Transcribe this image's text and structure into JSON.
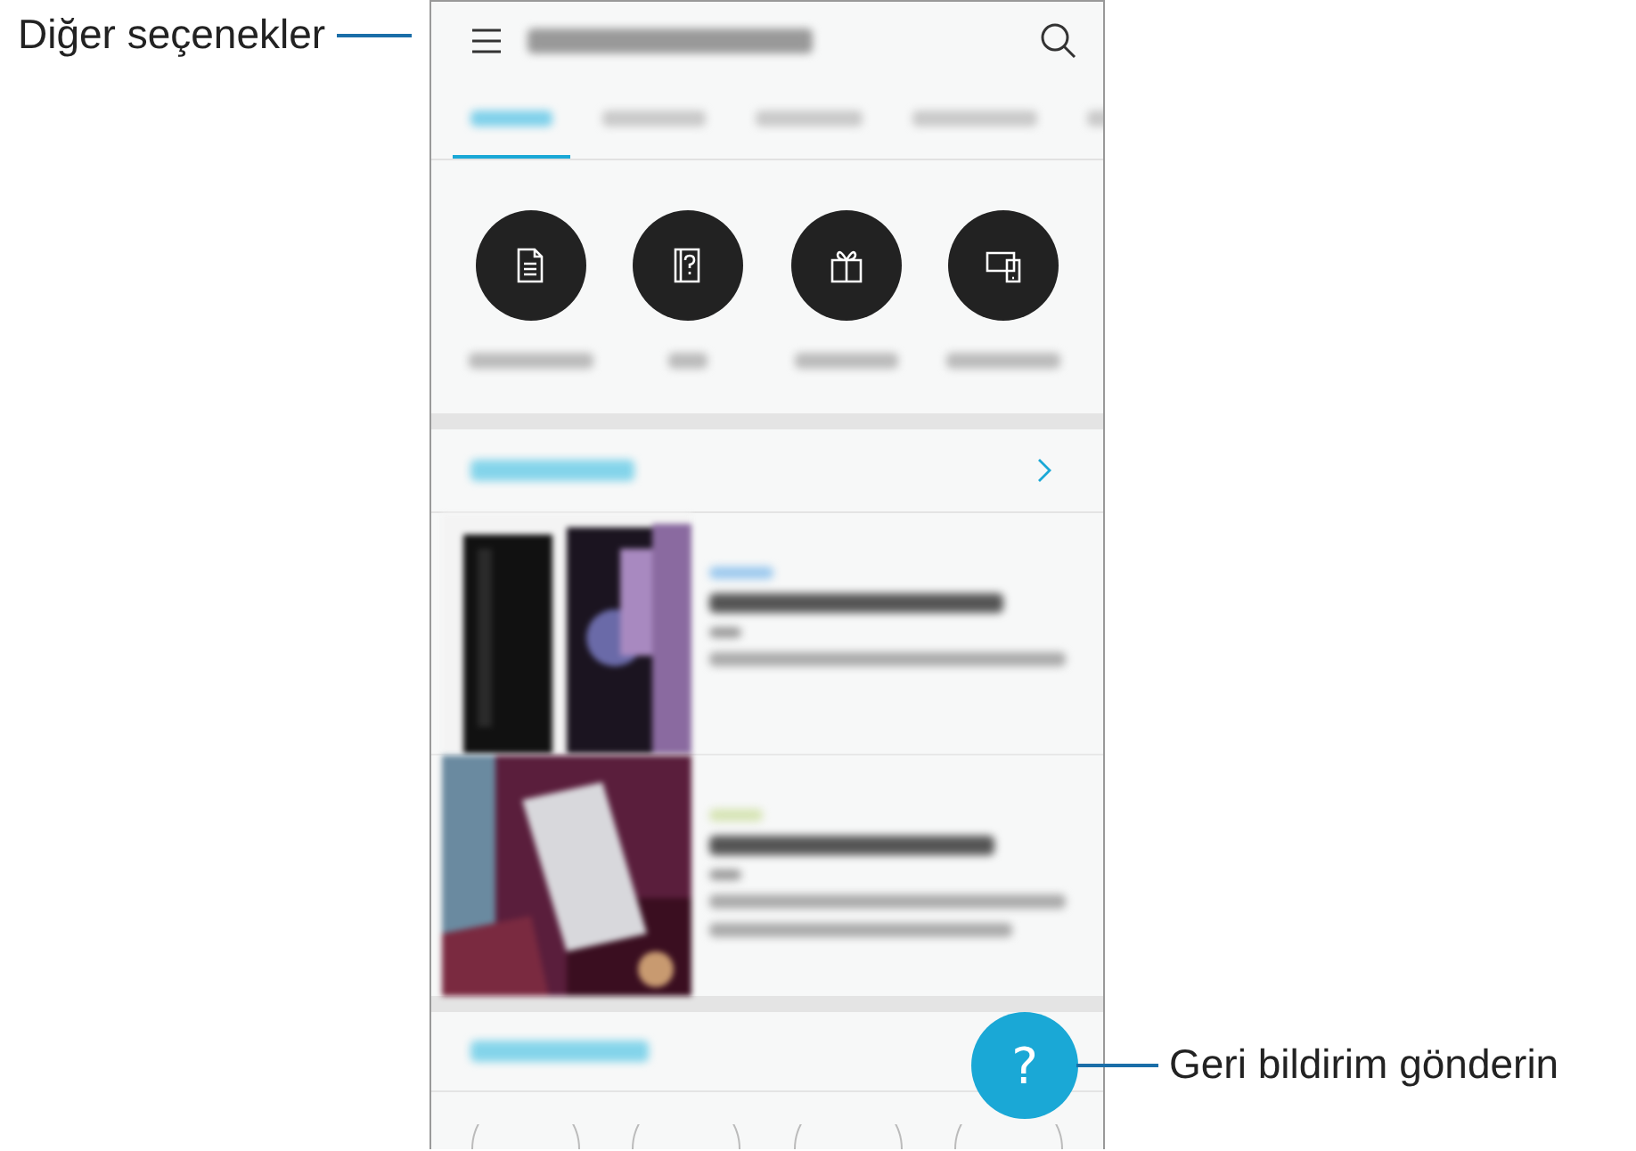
{
  "callouts": [
    {
      "text": "Diğer seçenekler",
      "kind": "left"
    },
    {
      "text": "Geri bildirim gönderin",
      "kind": "right"
    }
  ],
  "tabs": [
    {
      "selected": true
    },
    {
      "selected": false
    },
    {
      "selected": false
    },
    {
      "selected": false
    },
    {
      "selected": false
    }
  ],
  "shortcuts": [
    {
      "kind": "document"
    },
    {
      "kind": "manual"
    },
    {
      "kind": "gift"
    },
    {
      "kind": "devices"
    }
  ],
  "feedback_button": {
    "label": "?"
  }
}
